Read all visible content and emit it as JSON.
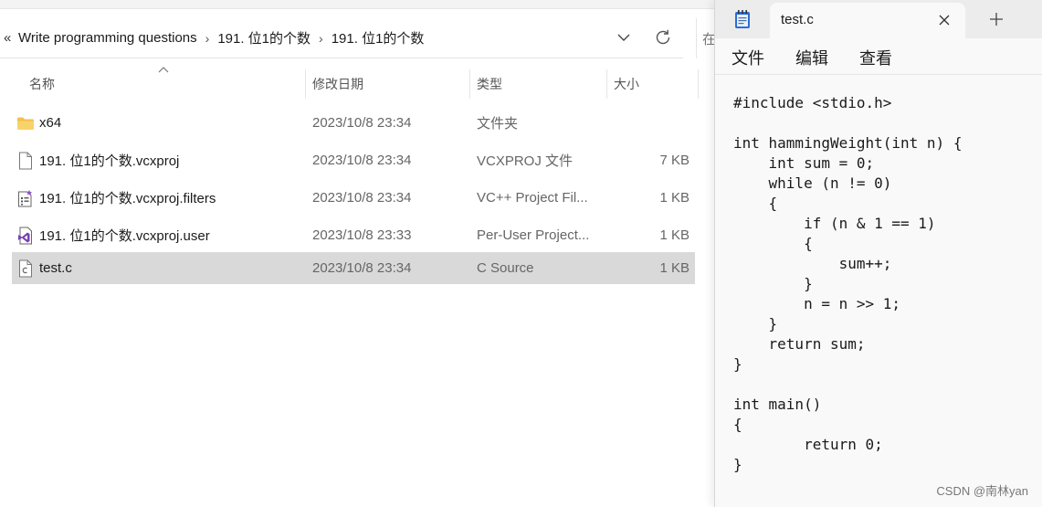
{
  "explorer": {
    "breadcrumb": {
      "back_glyph": "«",
      "segments": [
        "Write programming questions",
        "191. 位1的个数",
        "191. 位1的个数"
      ],
      "separator": "›"
    },
    "search_placeholder": "在",
    "columns": {
      "name": "名称",
      "date": "修改日期",
      "type": "类型",
      "size": "大小"
    },
    "files": [
      {
        "icon": "folder-icon",
        "name": "x64",
        "date": "2023/10/8 23:34",
        "type": "文件夹",
        "size": ""
      },
      {
        "icon": "file-icon",
        "name": "191. 位1的个数.vcxproj",
        "date": "2023/10/8 23:34",
        "type": "VCXPROJ 文件",
        "size": "7 KB"
      },
      {
        "icon": "filters-file-icon",
        "name": "191. 位1的个数.vcxproj.filters",
        "date": "2023/10/8 23:34",
        "type": "VC++ Project Fil...",
        "size": "1 KB"
      },
      {
        "icon": "vs-user-file-icon",
        "name": "191. 位1的个数.vcxproj.user",
        "date": "2023/10/8 23:33",
        "type": "Per-User Project...",
        "size": "1 KB"
      },
      {
        "icon": "c-source-file-icon",
        "name": "test.c",
        "date": "2023/10/8 23:34",
        "type": "C Source",
        "size": "1 KB"
      }
    ],
    "selected_index": 4
  },
  "notepad": {
    "tab_title": "test.c",
    "menu": [
      "文件",
      "编辑",
      "查看"
    ],
    "code": [
      "#include <stdio.h>",
      "",
      "int hammingWeight(int n) {",
      "    int sum = 0;",
      "    while (n != 0)",
      "    {",
      "        if (n & 1 == 1)",
      "        {",
      "            sum++;",
      "        }",
      "        n = n >> 1;",
      "    }",
      "    return sum;",
      "}",
      "",
      "int main()",
      "{",
      "        return 0;",
      "}"
    ]
  },
  "watermark": "CSDN @南林yan",
  "colors": {
    "selection": "#d9d9d9",
    "folder": "#f2c04b",
    "vs_purple": "#7b3fb5",
    "notepad_icon": "#2b6cd6"
  }
}
